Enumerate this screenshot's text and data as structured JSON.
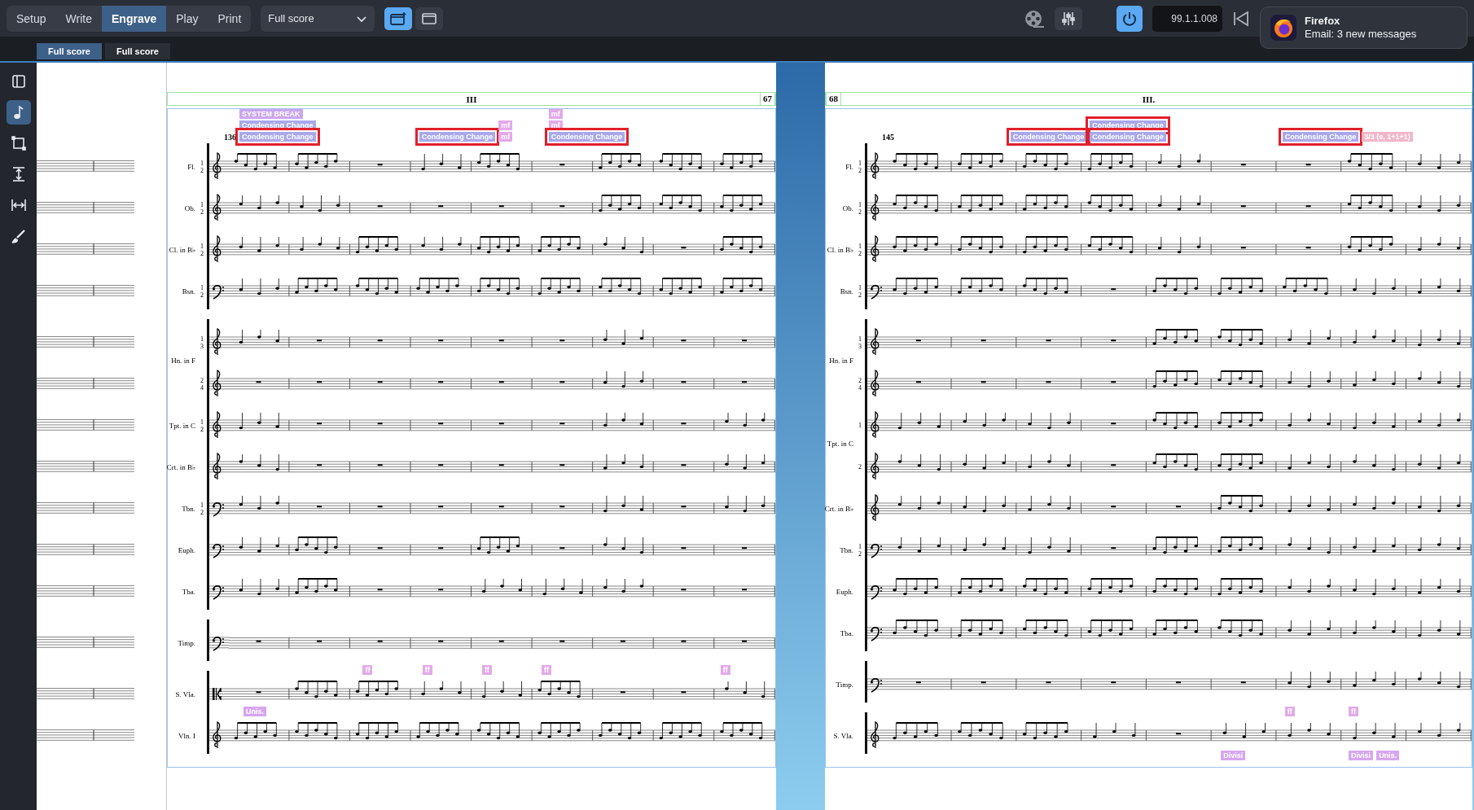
{
  "toolbar": {
    "modes": [
      {
        "label": "Setup",
        "selected": false
      },
      {
        "label": "Write",
        "selected": false
      },
      {
        "label": "Engrave",
        "selected": true
      },
      {
        "label": "Play",
        "selected": false
      },
      {
        "label": "Print",
        "selected": false
      }
    ],
    "layout_select": {
      "value": "Full score"
    },
    "view_buttons": [
      {
        "kind": "galley",
        "selected": true
      },
      {
        "kind": "page",
        "selected": false
      }
    ],
    "power_on": true,
    "time": "99.1.1.008"
  },
  "notification": {
    "app": "Firefox",
    "message": "Email: 3 new messages"
  },
  "tabs": [
    {
      "label": "Full score",
      "selected": true
    },
    {
      "label": "Full score",
      "selected": false
    }
  ],
  "tools": [
    {
      "kind": "panel",
      "selected": false
    },
    {
      "kind": "note",
      "selected": true
    },
    {
      "kind": "frame",
      "selected": false
    },
    {
      "kind": "vspace",
      "selected": false
    },
    {
      "kind": "hspace",
      "selected": false
    },
    {
      "kind": "brush",
      "selected": false
    }
  ],
  "pages": [
    {
      "number": "67",
      "title": "III",
      "measure_number": "136",
      "groups": [
        {
          "sections": [
            {
              "label": "Fl.",
              "kind": "treble",
              "staves": [
                {
                  "parts": [
                    "1",
                    "2"
                  ],
                  "bars": [
                    {
                      "kind": "beamed",
                      "signposts": [
                        {
                          "text": "SYSTEM BREAK",
                          "color": "#cba6f0",
                          "flagged": false
                        },
                        {
                          "text": "Condensing Change",
                          "color": "#a9a8ea",
                          "flagged": false
                        },
                        {
                          "text": "Condensing Change",
                          "color": "#a9a8ea",
                          "flagged": true
                        }
                      ]
                    },
                    {
                      "kind": "beamed"
                    },
                    {
                      "kind": "rest"
                    },
                    {
                      "kind": "notes",
                      "signposts": [
                        {
                          "text": "Condensing Change",
                          "color": "#a9a8ea",
                          "flagged": true
                        }
                      ]
                    },
                    {
                      "kind": "beamed",
                      "signposts": [
                        {
                          "text": "mf",
                          "color": "#e3a9e9",
                          "flagged": false
                        },
                        {
                          "text": "mf",
                          "color": "#e3a9e9",
                          "flagged": false
                        }
                      ]
                    },
                    {
                      "kind": "rest",
                      "signposts": [
                        {
                          "text": "mf",
                          "color": "#e3a9e9",
                          "flagged": false
                        },
                        {
                          "text": "mf",
                          "color": "#e3a9e9",
                          "flagged": false
                        },
                        {
                          "text": "Condensing Change",
                          "color": "#a9a8ea",
                          "flagged": true
                        }
                      ]
                    },
                    {
                      "kind": "beamed"
                    },
                    {
                      "kind": "beamed"
                    },
                    {
                      "kind": "beamed"
                    }
                  ]
                }
              ]
            },
            {
              "label": "Ob.",
              "kind": "treble",
              "staves": [
                {
                  "parts": [
                    "1",
                    "2"
                  ],
                  "bars": [
                    {
                      "kind": "notes"
                    },
                    {
                      "kind": "notes"
                    },
                    {
                      "kind": "rest"
                    },
                    {
                      "kind": "rest"
                    },
                    {
                      "kind": "rest"
                    },
                    {
                      "kind": "rest"
                    },
                    {
                      "kind": "beamed"
                    },
                    {
                      "kind": "beamed"
                    },
                    {
                      "kind": "beamed"
                    }
                  ]
                }
              ]
            },
            {
              "label": "Cl. in B♭",
              "kind": "treble",
              "staves": [
                {
                  "parts": [
                    "1",
                    "2"
                  ],
                  "bars": [
                    {
                      "kind": "notes"
                    },
                    {
                      "kind": "notes"
                    },
                    {
                      "kind": "beamed"
                    },
                    {
                      "kind": "notes"
                    },
                    {
                      "kind": "beamed"
                    },
                    {
                      "kind": "beamed"
                    },
                    {
                      "kind": "notes"
                    },
                    {
                      "kind": "rest"
                    },
                    {
                      "kind": "beamed"
                    }
                  ]
                }
              ]
            },
            {
              "label": "Bsn.",
              "kind": "bass",
              "staves": [
                {
                  "parts": [
                    "1",
                    "2"
                  ],
                  "bars": [
                    {
                      "kind": "notes"
                    },
                    {
                      "kind": "beamed"
                    },
                    {
                      "kind": "beamed"
                    },
                    {
                      "kind": "beamed"
                    },
                    {
                      "kind": "beamed"
                    },
                    {
                      "kind": "beamed"
                    },
                    {
                      "kind": "beamed"
                    },
                    {
                      "kind": "beamed"
                    },
                    {
                      "kind": "beamed"
                    }
                  ]
                }
              ]
            }
          ]
        },
        {
          "sections": [
            {
              "label": "Hn. in F",
              "kind": "treble",
              "staves": [
                {
                  "parts": [
                    "1",
                    "3"
                  ],
                  "bars": [
                    {
                      "kind": "notes"
                    },
                    {
                      "kind": "rest"
                    },
                    {
                      "kind": "rest"
                    },
                    {
                      "kind": "rest"
                    },
                    {
                      "kind": "rest"
                    },
                    {
                      "kind": "rest"
                    },
                    {
                      "kind": "notes"
                    },
                    {
                      "kind": "rest"
                    },
                    {
                      "kind": "rest"
                    }
                  ]
                },
                {
                  "parts": [
                    "2",
                    "4"
                  ],
                  "bars": [
                    {
                      "kind": "rest"
                    },
                    {
                      "kind": "rest"
                    },
                    {
                      "kind": "rest"
                    },
                    {
                      "kind": "rest"
                    },
                    {
                      "kind": "rest"
                    },
                    {
                      "kind": "rest"
                    },
                    {
                      "kind": "notes"
                    },
                    {
                      "kind": "rest"
                    },
                    {
                      "kind": "rest"
                    }
                  ]
                }
              ]
            },
            {
              "label": "Tpt. in C",
              "kind": "treble",
              "staves": [
                {
                  "parts": [
                    "1",
                    "2"
                  ],
                  "bars": [
                    {
                      "kind": "notes"
                    },
                    {
                      "kind": "rest"
                    },
                    {
                      "kind": "rest"
                    },
                    {
                      "kind": "rest"
                    },
                    {
                      "kind": "rest"
                    },
                    {
                      "kind": "rest"
                    },
                    {
                      "kind": "notes"
                    },
                    {
                      "kind": "rest"
                    },
                    {
                      "kind": "notes"
                    }
                  ]
                }
              ]
            },
            {
              "label": "Crt. in B♭",
              "kind": "treble",
              "staves": [
                {
                  "bars": [
                    {
                      "kind": "notes"
                    },
                    {
                      "kind": "rest"
                    },
                    {
                      "kind": "rest"
                    },
                    {
                      "kind": "rest"
                    },
                    {
                      "kind": "rest"
                    },
                    {
                      "kind": "rest"
                    },
                    {
                      "kind": "notes"
                    },
                    {
                      "kind": "rest"
                    },
                    {
                      "kind": "notes"
                    }
                  ]
                }
              ]
            },
            {
              "label": "Tbn.",
              "kind": "bass",
              "staves": [
                {
                  "parts": [
                    "1",
                    "2"
                  ],
                  "bars": [
                    {
                      "kind": "notes"
                    },
                    {
                      "kind": "rest"
                    },
                    {
                      "kind": "rest"
                    },
                    {
                      "kind": "rest"
                    },
                    {
                      "kind": "rest"
                    },
                    {
                      "kind": "rest"
                    },
                    {
                      "kind": "notes"
                    },
                    {
                      "kind": "rest"
                    },
                    {
                      "kind": "notes"
                    }
                  ]
                }
              ]
            },
            {
              "label": "Euph.",
              "kind": "bass",
              "staves": [
                {
                  "bars": [
                    {
                      "kind": "notes"
                    },
                    {
                      "kind": "beamed"
                    },
                    {
                      "kind": "rest"
                    },
                    {
                      "kind": "rest"
                    },
                    {
                      "kind": "beamed"
                    },
                    {
                      "kind": "rest"
                    },
                    {
                      "kind": "notes"
                    },
                    {
                      "kind": "rest"
                    },
                    {
                      "kind": "rest"
                    }
                  ]
                }
              ]
            },
            {
              "label": "Tba.",
              "kind": "bass",
              "staves": [
                {
                  "bars": [
                    {
                      "kind": "notes"
                    },
                    {
                      "kind": "beamed"
                    },
                    {
                      "kind": "rest"
                    },
                    {
                      "kind": "rest"
                    },
                    {
                      "kind": "notes"
                    },
                    {
                      "kind": "notes"
                    },
                    {
                      "kind": "notes"
                    },
                    {
                      "kind": "rest"
                    },
                    {
                      "kind": "rest"
                    }
                  ]
                }
              ]
            }
          ]
        },
        {
          "sections": [
            {
              "label": "Timp.",
              "kind": "bass",
              "staves": [
                {
                  "bars": [
                    {
                      "kind": "rest"
                    },
                    {
                      "kind": "rest"
                    },
                    {
                      "kind": "rest"
                    },
                    {
                      "kind": "rest"
                    },
                    {
                      "kind": "rest"
                    },
                    {
                      "kind": "rest"
                    },
                    {
                      "kind": "rest"
                    },
                    {
                      "kind": "rest"
                    },
                    {
                      "kind": "rest"
                    }
                  ]
                }
              ]
            }
          ]
        },
        {
          "sections": [
            {
              "label": "S. Vla.",
              "kind": "alto",
              "staves": [
                {
                  "bars": [
                    {
                      "kind": "rest"
                    },
                    {
                      "kind": "beamed"
                    },
                    {
                      "kind": "beamed",
                      "above": [
                        {
                          "text": "ff",
                          "color": "#e3a9e9"
                        }
                      ]
                    },
                    {
                      "kind": "notes",
                      "above": [
                        {
                          "text": "ff",
                          "color": "#e3a9e9"
                        }
                      ]
                    },
                    {
                      "kind": "notes",
                      "above": [
                        {
                          "text": "ff",
                          "color": "#e3a9e9"
                        }
                      ]
                    },
                    {
                      "kind": "beamed",
                      "above": [
                        {
                          "text": "ff",
                          "color": "#e3a9e9"
                        }
                      ]
                    },
                    {
                      "kind": "rest"
                    },
                    {
                      "kind": "rest"
                    },
                    {
                      "kind": "notes",
                      "above": [
                        {
                          "text": "ff",
                          "color": "#e3a9e9"
                        }
                      ]
                    }
                  ]
                }
              ]
            },
            {
              "label": "Vln. I",
              "kind": "treble",
              "staves": [
                {
                  "bars": [
                    {
                      "kind": "beamed",
                      "above": [
                        {
                          "text": "Unis.",
                          "color": "#d7a6f0"
                        }
                      ]
                    },
                    {
                      "kind": "beamed"
                    },
                    {
                      "kind": "beamed"
                    },
                    {
                      "kind": "beamed"
                    },
                    {
                      "kind": "beamed"
                    },
                    {
                      "kind": "beamed"
                    },
                    {
                      "kind": "beamed"
                    },
                    {
                      "kind": "beamed"
                    },
                    {
                      "kind": "beamed"
                    }
                  ]
                }
              ]
            }
          ]
        }
      ]
    },
    {
      "number": "68",
      "title": "III.",
      "measure_number": "145",
      "groups": [
        {
          "sections": [
            {
              "label": "Fl.",
              "kind": "treble",
              "staves": [
                {
                  "parts": [
                    "1",
                    "2"
                  ],
                  "bars": [
                    {
                      "kind": "beamed"
                    },
                    {
                      "kind": "beamed"
                    },
                    {
                      "kind": "beamed",
                      "signposts": [
                        {
                          "text": "Condensing Change",
                          "color": "#a9a8ea",
                          "flagged": true
                        }
                      ]
                    },
                    {
                      "kind": "beamed",
                      "signposts": [
                        {
                          "text": "Condensing Change",
                          "color": "#a9a8ea",
                          "flagged": true
                        },
                        {
                          "text": "Condensing Change",
                          "color": "#a9a8ea",
                          "flagged": true
                        }
                      ]
                    },
                    {
                      "kind": "notes"
                    },
                    {
                      "kind": "rest"
                    },
                    {
                      "kind": "rest",
                      "signposts": [
                        {
                          "text": "Condensing Change",
                          "color": "#a9a8ea",
                          "flagged": true
                        }
                      ]
                    },
                    {
                      "kind": "beamed",
                      "signposts": [
                        {
                          "text": "3/3 (e, 1+1+1)",
                          "color": "#f2b6c9",
                          "flagged": false
                        }
                      ]
                    },
                    {
                      "kind": "notes"
                    }
                  ]
                }
              ]
            },
            {
              "label": "Ob.",
              "kind": "treble",
              "staves": [
                {
                  "parts": [
                    "1",
                    "2"
                  ],
                  "bars": [
                    {
                      "kind": "beamed"
                    },
                    {
                      "kind": "beamed"
                    },
                    {
                      "kind": "beamed"
                    },
                    {
                      "kind": "beamed"
                    },
                    {
                      "kind": "notes"
                    },
                    {
                      "kind": "rest"
                    },
                    {
                      "kind": "rest"
                    },
                    {
                      "kind": "beamed"
                    },
                    {
                      "kind": "notes"
                    }
                  ]
                }
              ]
            },
            {
              "label": "Cl. in B♭",
              "kind": "treble",
              "staves": [
                {
                  "parts": [
                    "1",
                    "2"
                  ],
                  "bars": [
                    {
                      "kind": "beamed"
                    },
                    {
                      "kind": "beamed"
                    },
                    {
                      "kind": "beamed"
                    },
                    {
                      "kind": "beamed"
                    },
                    {
                      "kind": "notes"
                    },
                    {
                      "kind": "rest"
                    },
                    {
                      "kind": "rest"
                    },
                    {
                      "kind": "beamed"
                    },
                    {
                      "kind": "notes"
                    }
                  ]
                }
              ]
            },
            {
              "label": "Bsn.",
              "kind": "bass",
              "staves": [
                {
                  "parts": [
                    "1",
                    "2"
                  ],
                  "bars": [
                    {
                      "kind": "beamed"
                    },
                    {
                      "kind": "beamed"
                    },
                    {
                      "kind": "beamed"
                    },
                    {
                      "kind": "rest"
                    },
                    {
                      "kind": "beamed"
                    },
                    {
                      "kind": "beamed"
                    },
                    {
                      "kind": "beamed"
                    },
                    {
                      "kind": "notes"
                    },
                    {
                      "kind": "notes"
                    }
                  ]
                }
              ]
            }
          ]
        },
        {
          "sections": [
            {
              "label": "Hn. in F",
              "kind": "treble",
              "staves": [
                {
                  "parts": [
                    "1",
                    "3"
                  ],
                  "bars": [
                    {
                      "kind": "rest"
                    },
                    {
                      "kind": "rest"
                    },
                    {
                      "kind": "rest"
                    },
                    {
                      "kind": "rest"
                    },
                    {
                      "kind": "beamed"
                    },
                    {
                      "kind": "beamed"
                    },
                    {
                      "kind": "notes"
                    },
                    {
                      "kind": "notes"
                    },
                    {
                      "kind": "notes"
                    }
                  ]
                },
                {
                  "parts": [
                    "2",
                    "4"
                  ],
                  "bars": [
                    {
                      "kind": "rest"
                    },
                    {
                      "kind": "rest"
                    },
                    {
                      "kind": "rest"
                    },
                    {
                      "kind": "rest"
                    },
                    {
                      "kind": "beamed"
                    },
                    {
                      "kind": "beamed"
                    },
                    {
                      "kind": "notes"
                    },
                    {
                      "kind": "notes"
                    },
                    {
                      "kind": "notes"
                    }
                  ]
                }
              ]
            },
            {
              "label": "Tpt. in C",
              "kind": "treble",
              "staves": [
                {
                  "parts": [
                    "1"
                  ],
                  "bars": [
                    {
                      "kind": "notes"
                    },
                    {
                      "kind": "notes"
                    },
                    {
                      "kind": "notes"
                    },
                    {
                      "kind": "rest"
                    },
                    {
                      "kind": "beamed"
                    },
                    {
                      "kind": "beamed"
                    },
                    {
                      "kind": "notes"
                    },
                    {
                      "kind": "notes"
                    },
                    {
                      "kind": "notes"
                    }
                  ]
                },
                {
                  "parts": [
                    "2"
                  ],
                  "bars": [
                    {
                      "kind": "notes"
                    },
                    {
                      "kind": "notes"
                    },
                    {
                      "kind": "notes"
                    },
                    {
                      "kind": "rest"
                    },
                    {
                      "kind": "beamed"
                    },
                    {
                      "kind": "beamed"
                    },
                    {
                      "kind": "notes"
                    },
                    {
                      "kind": "notes"
                    },
                    {
                      "kind": "notes"
                    }
                  ]
                }
              ]
            },
            {
              "label": "Crt. in B♭",
              "kind": "treble",
              "staves": [
                {
                  "bars": [
                    {
                      "kind": "notes"
                    },
                    {
                      "kind": "notes"
                    },
                    {
                      "kind": "notes"
                    },
                    {
                      "kind": "rest"
                    },
                    {
                      "kind": "rest"
                    },
                    {
                      "kind": "beamed"
                    },
                    {
                      "kind": "notes"
                    },
                    {
                      "kind": "notes"
                    },
                    {
                      "kind": "notes"
                    }
                  ]
                }
              ]
            },
            {
              "label": "Tbn.",
              "kind": "bass",
              "staves": [
                {
                  "parts": [
                    "1",
                    "2"
                  ],
                  "bars": [
                    {
                      "kind": "notes"
                    },
                    {
                      "kind": "notes"
                    },
                    {
                      "kind": "notes"
                    },
                    {
                      "kind": "rest"
                    },
                    {
                      "kind": "beamed"
                    },
                    {
                      "kind": "beamed"
                    },
                    {
                      "kind": "notes"
                    },
                    {
                      "kind": "notes"
                    },
                    {
                      "kind": "notes"
                    }
                  ]
                }
              ]
            },
            {
              "label": "Euph.",
              "kind": "bass",
              "staves": [
                {
                  "bars": [
                    {
                      "kind": "beamed"
                    },
                    {
                      "kind": "beamed"
                    },
                    {
                      "kind": "beamed"
                    },
                    {
                      "kind": "beamed"
                    },
                    {
                      "kind": "beamed"
                    },
                    {
                      "kind": "beamed"
                    },
                    {
                      "kind": "notes"
                    },
                    {
                      "kind": "notes"
                    },
                    {
                      "kind": "notes"
                    }
                  ]
                }
              ]
            },
            {
              "label": "Tba.",
              "kind": "bass",
              "staves": [
                {
                  "bars": [
                    {
                      "kind": "beamed"
                    },
                    {
                      "kind": "beamed"
                    },
                    {
                      "kind": "beamed"
                    },
                    {
                      "kind": "beamed"
                    },
                    {
                      "kind": "beamed"
                    },
                    {
                      "kind": "beamed"
                    },
                    {
                      "kind": "notes"
                    },
                    {
                      "kind": "notes"
                    },
                    {
                      "kind": "notes"
                    }
                  ]
                }
              ]
            }
          ]
        },
        {
          "sections": [
            {
              "label": "Timp.",
              "kind": "bass",
              "staves": [
                {
                  "bars": [
                    {
                      "kind": "rest"
                    },
                    {
                      "kind": "rest"
                    },
                    {
                      "kind": "rest"
                    },
                    {
                      "kind": "rest"
                    },
                    {
                      "kind": "rest"
                    },
                    {
                      "kind": "rest"
                    },
                    {
                      "kind": "notes"
                    },
                    {
                      "kind": "notes"
                    },
                    {
                      "kind": "notes"
                    }
                  ]
                }
              ]
            }
          ]
        },
        {
          "sections": [
            {
              "label": "S. Vla.",
              "kind": "treble",
              "staves": [
                {
                  "bars": [
                    {
                      "kind": "beamed"
                    },
                    {
                      "kind": "beamed"
                    },
                    {
                      "kind": "beamed"
                    },
                    {
                      "kind": "notes"
                    },
                    {
                      "kind": "rest"
                    },
                    {
                      "kind": "notes",
                      "below": [
                        {
                          "text": "Divisi",
                          "color": "#d7a6f0"
                        }
                      ]
                    },
                    {
                      "kind": "notes",
                      "above": [
                        {
                          "text": "ff",
                          "color": "#e3a9e9"
                        }
                      ]
                    },
                    {
                      "kind": "notes",
                      "above": [
                        {
                          "text": "ff",
                          "color": "#e3a9e9"
                        }
                      ],
                      "below": [
                        {
                          "text": "Divisi",
                          "color": "#d7a6f0"
                        },
                        {
                          "text": "Unis.",
                          "color": "#d7a6f0"
                        }
                      ]
                    },
                    {
                      "kind": "notes"
                    }
                  ]
                }
              ]
            }
          ]
        }
      ]
    }
  ]
}
